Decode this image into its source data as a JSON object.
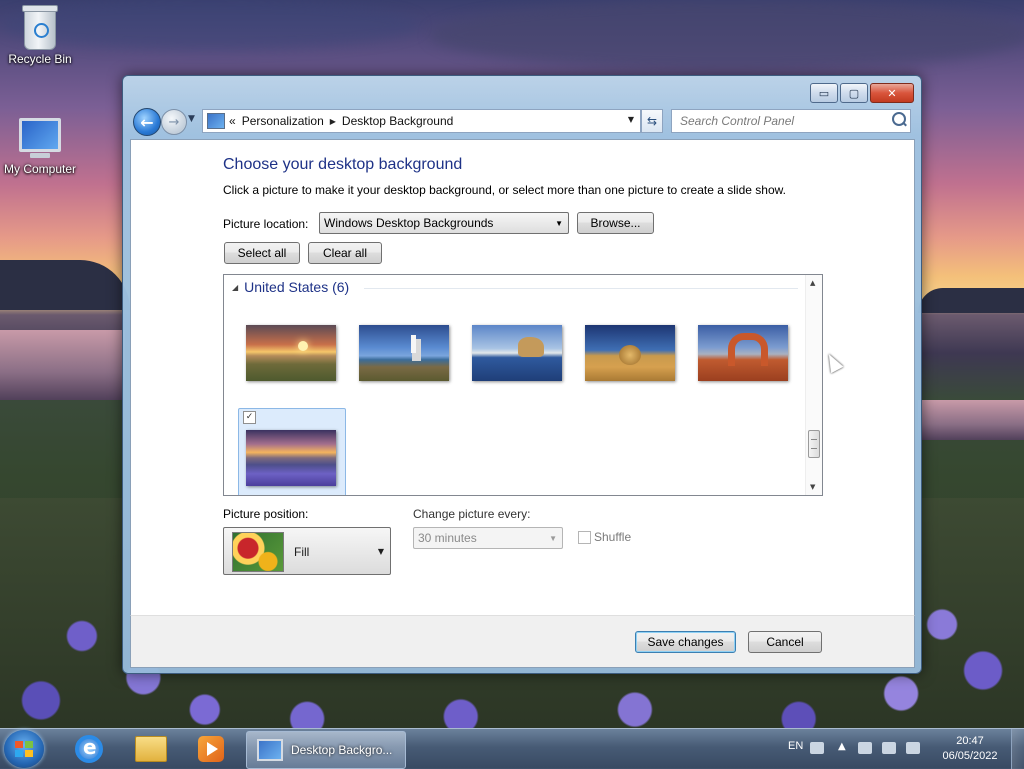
{
  "desktop": {
    "icons": [
      {
        "label": "Recycle Bin"
      },
      {
        "label": "My Computer"
      }
    ]
  },
  "window": {
    "caption_buttons": {
      "minimize": "▭",
      "maximize": "▢",
      "close": "✕"
    },
    "navigation": {
      "back_icon": "back-arrow-icon",
      "forward_icon": "forward-arrow-icon",
      "breadcrumb_prefix": "«",
      "breadcrumbs": [
        "Personalization",
        "Desktop Background"
      ],
      "refresh_icon": "refresh-icon",
      "search_placeholder": "Search Control Panel"
    },
    "main": {
      "title": "Choose your desktop background",
      "subtitle": "Click a picture to make it your desktop background, or select more than one picture to create a slide show.",
      "picture_location_label": "Picture location:",
      "picture_location_value": "Windows Desktop Backgrounds",
      "browse_label": "Browse...",
      "select_all_label": "Select all",
      "clear_all_label": "Clear all",
      "gallery": {
        "group_label": "United States (6)",
        "pictures": [
          {
            "name": "sunset-field",
            "selected": false
          },
          {
            "name": "lighthouse",
            "selected": false
          },
          {
            "name": "lake-rock",
            "selected": false
          },
          {
            "name": "hay-bale",
            "selected": false
          },
          {
            "name": "arch",
            "selected": false
          },
          {
            "name": "lupine-sunset",
            "selected": true
          }
        ]
      },
      "picture_position_label": "Picture position:",
      "picture_position_value": "Fill",
      "change_every_label": "Change picture every:",
      "change_every_value": "30 minutes",
      "shuffle_label": "Shuffle",
      "shuffle_checked": false
    },
    "footer": {
      "save_label": "Save changes",
      "cancel_label": "Cancel"
    }
  },
  "taskbar": {
    "active_task_label": "Desktop Backgro...",
    "language": "EN",
    "time": "20:47",
    "date": "06/05/2022"
  },
  "colors": {
    "heading_blue": "#1e3287",
    "selection_fill": "#dcebfc",
    "default_button_border": "#3c7fb1"
  }
}
